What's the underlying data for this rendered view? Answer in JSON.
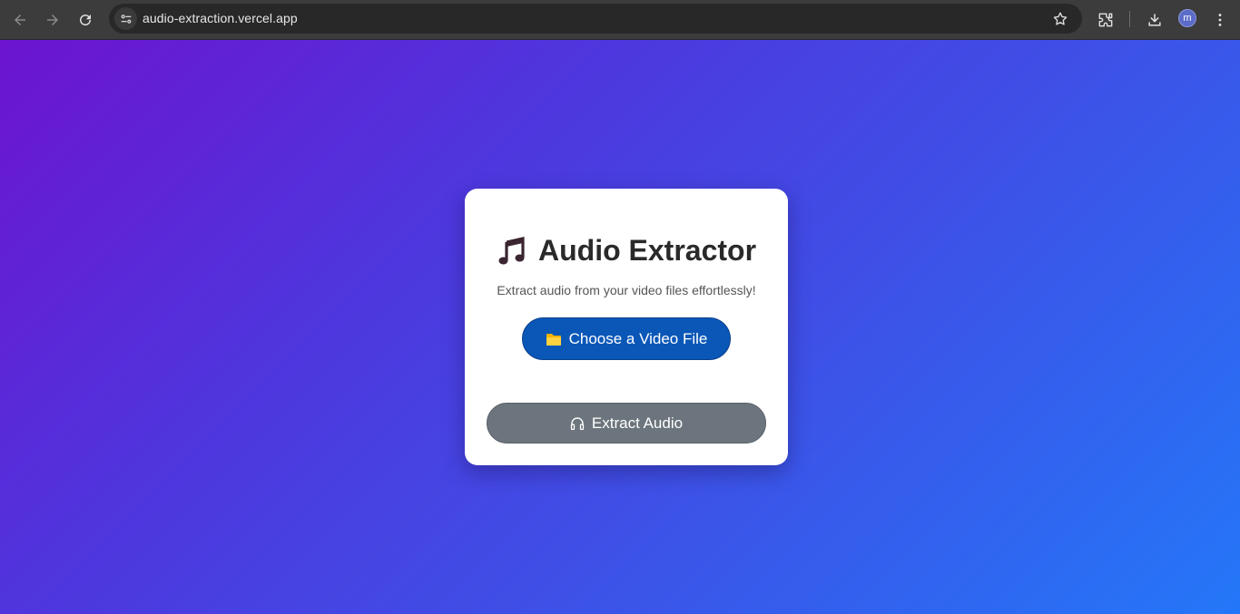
{
  "browser": {
    "url": "audio-extraction.vercel.app",
    "profile_initial": "m",
    "icons": [
      "back-icon",
      "forward-icon",
      "reload-icon",
      "site-info-icon",
      "star-icon",
      "extensions-icon",
      "download-icon",
      "menu-icon"
    ]
  },
  "app": {
    "title": "Audio Extractor",
    "subtitle": "Extract audio from your video files effortlessly!",
    "choose_button_label": "Choose a Video File",
    "extract_button_label": "Extract Audio"
  },
  "colors": {
    "gradient_start": "#6c14cf",
    "gradient_end": "#2477f8",
    "choose_button": "#0a57b8",
    "extract_button": "#6c757d",
    "card": "#ffffff"
  }
}
